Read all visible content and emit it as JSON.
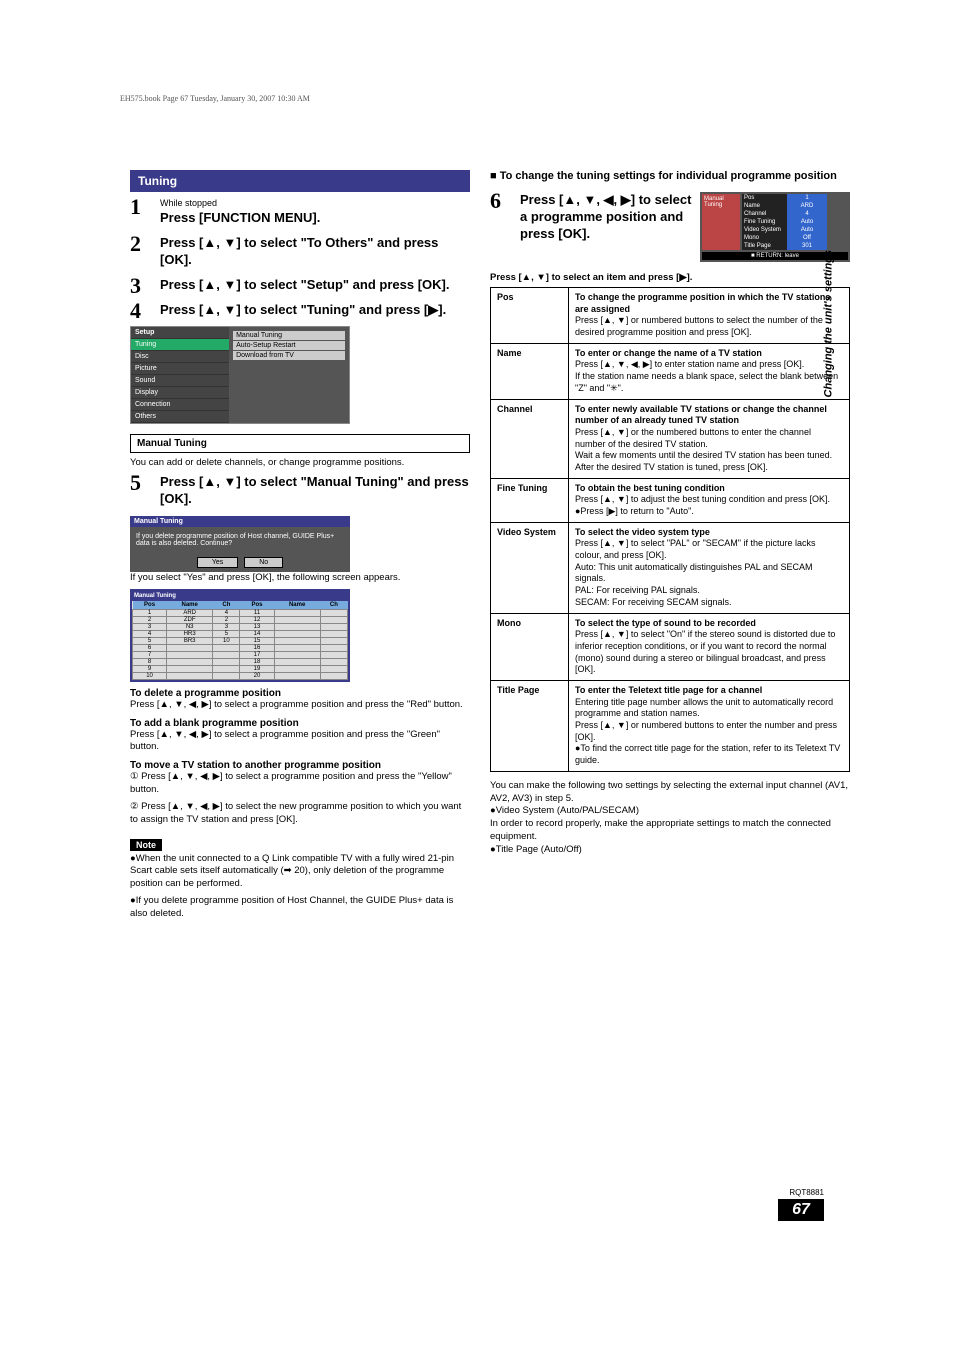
{
  "book_line": "EH575.book  Page 67  Tuesday, January 30, 2007  10:30 AM",
  "section_title": "Tuning",
  "steps_left": [
    {
      "num": "1",
      "small": "While stopped",
      "text": "Press [FUNCTION MENU]."
    },
    {
      "num": "2",
      "small": "",
      "text": "Press [▲, ▼] to select \"To Others\" and press [OK]."
    },
    {
      "num": "3",
      "small": "",
      "text": "Press [▲, ▼] to select \"Setup\" and press [OK]."
    },
    {
      "num": "4",
      "small": "",
      "text": "Press [▲, ▼] to select \"Tuning\" and press [▶]."
    }
  ],
  "osd_setup": {
    "header": "Setup",
    "menu": [
      "Tuning",
      "Disc",
      "Picture",
      "Sound",
      "Display",
      "Connection",
      "Others"
    ],
    "panel": [
      "Manual Tuning",
      "Auto-Setup Restart",
      "Download from TV"
    ]
  },
  "manual_tuning_head": "Manual Tuning",
  "manual_tuning_intro": "You can add or delete channels, or change programme positions.",
  "step5": {
    "num": "5",
    "text": "Press [▲, ▼] to select \"Manual Tuning\" and press [OK]."
  },
  "osd_confirm": {
    "header": "Manual Tuning",
    "msg": "If you delete programme position of Host channel, GUIDE Plus+ data is also deleted. Continue?",
    "yes": "Yes",
    "no": "No"
  },
  "confirm_after": "If you select \"Yes\" and press [OK], the following screen appears.",
  "osd_list": {
    "header": "Manual Tuning",
    "cols": [
      "Pos",
      "Name",
      "Ch",
      "Pos",
      "Name",
      "Ch"
    ],
    "rows": [
      [
        "1",
        "ARD",
        "4",
        "11",
        "",
        ""
      ],
      [
        "2",
        "ZDF",
        "2",
        "12",
        "",
        ""
      ],
      [
        "3",
        "N3",
        "3",
        "13",
        "",
        ""
      ],
      [
        "4",
        "HR3",
        "5",
        "14",
        "",
        ""
      ],
      [
        "5",
        "BR3",
        "10",
        "15",
        "",
        ""
      ],
      [
        "6",
        "",
        "",
        "16",
        "",
        ""
      ],
      [
        "7",
        "",
        "",
        "17",
        "",
        ""
      ],
      [
        "8",
        "",
        "",
        "18",
        "",
        ""
      ],
      [
        "9",
        "",
        "",
        "19",
        "",
        ""
      ],
      [
        "10",
        "",
        "",
        "20",
        "",
        ""
      ]
    ]
  },
  "delete_head": "To delete a programme position",
  "delete_body": "Press [▲, ▼, ◀, ▶] to select a programme position and press the \"Red\" button.",
  "add_head": "To add a blank programme position",
  "add_body": "Press [▲, ▼, ◀, ▶] to select a programme position and press the \"Green\" button.",
  "move_head": "To move a TV station to another programme position",
  "move_1": "① Press [▲, ▼, ◀, ▶] to select a programme position and press the \"Yellow\" button.",
  "move_2": "② Press [▲, ▼, ◀, ▶] to select the new programme position to which you want to assign the TV station and press [OK].",
  "note_label": "Note",
  "note_1": "●When the unit connected to a Q Link compatible TV with a fully wired 21-pin Scart cable sets itself automatically (➡ 20), only deletion of the programme position can be performed.",
  "note_2": "●If you delete programme position of Host Channel, the GUIDE Plus+ data is also deleted.",
  "right_intro_bullet": "■",
  "right_intro": "To change the tuning settings for individual programme position",
  "step6": {
    "num": "6",
    "text": "Press [▲, ▼, ◀, ▶] to select a programme position and press [OK]."
  },
  "osd_manual": {
    "side": "Manual Tuning",
    "rows": [
      [
        "Pos",
        "1"
      ],
      [
        "Name",
        "ARD"
      ],
      [
        "Channel",
        "4"
      ],
      [
        "Fine Tuning",
        "Auto"
      ],
      [
        "Video System",
        "Auto"
      ],
      [
        "Mono",
        "Off"
      ],
      [
        "Title Page",
        "301"
      ]
    ],
    "footer": "■ RETURN: leave"
  },
  "spec_line": "Press [▲, ▼] to select an item and press [▶].",
  "spec_rows": [
    {
      "k": "Pos",
      "v": "To change the programme position in which the TV stations are assigned\nPress [▲, ▼] or numbered buttons to select the number of the desired programme position and press [OK]."
    },
    {
      "k": "Name",
      "v": "To enter or change the name of a TV station\nPress [▲, ▼, ◀, ▶] to enter station name and press [OK].\nIf the station name needs a blank space, select the blank between \"Z\" and \"✳\"."
    },
    {
      "k": "Channel",
      "v": "To enter newly available TV stations or change the channel number of an already tuned TV station\nPress [▲, ▼] or the numbered buttons to enter the channel number of the desired TV station.\nWait a few moments until the desired TV station has been tuned.\nAfter the desired TV station is tuned, press [OK]."
    },
    {
      "k": "Fine Tuning",
      "v": "To obtain the best tuning condition\nPress [▲, ▼] to adjust the best tuning condition and press [OK].\n●Press [▶] to return to \"Auto\"."
    },
    {
      "k": "Video System",
      "v": "To select the video system type\nPress [▲, ▼] to select \"PAL\" or \"SECAM\" if the picture lacks colour, and press [OK].\nAuto:    This unit automatically distinguishes PAL and SECAM signals.\nPAL:     For receiving PAL signals.\nSECAM: For receiving SECAM signals."
    },
    {
      "k": "Mono",
      "v": "To select the type of sound to be recorded\nPress [▲, ▼] to select \"On\" if the stereo sound is distorted due to inferior reception conditions, or if you want to record the normal (mono) sound during a stereo or bilingual broadcast, and press [OK]."
    },
    {
      "k": "Title Page",
      "v": "To enter the Teletext title page for a channel\nEntering title page number allows the unit to automatically record programme and station names.\nPress [▲, ▼] or numbered buttons to enter the number and press [OK].\n●To find the correct title page for the station, refer to its Teletext TV guide."
    }
  ],
  "after_table": [
    "You can make the following two settings by selecting the external input channel (AV1, AV2, AV3) in step 5.",
    "●Video System (Auto/PAL/SECAM)",
    "  In order to record properly, make the appropriate settings to match the connected equipment.",
    "●Title Page (Auto/Off)"
  ],
  "side_label": "Changing the unit's settings",
  "footer_code": "RQT8881",
  "page_num": "67"
}
